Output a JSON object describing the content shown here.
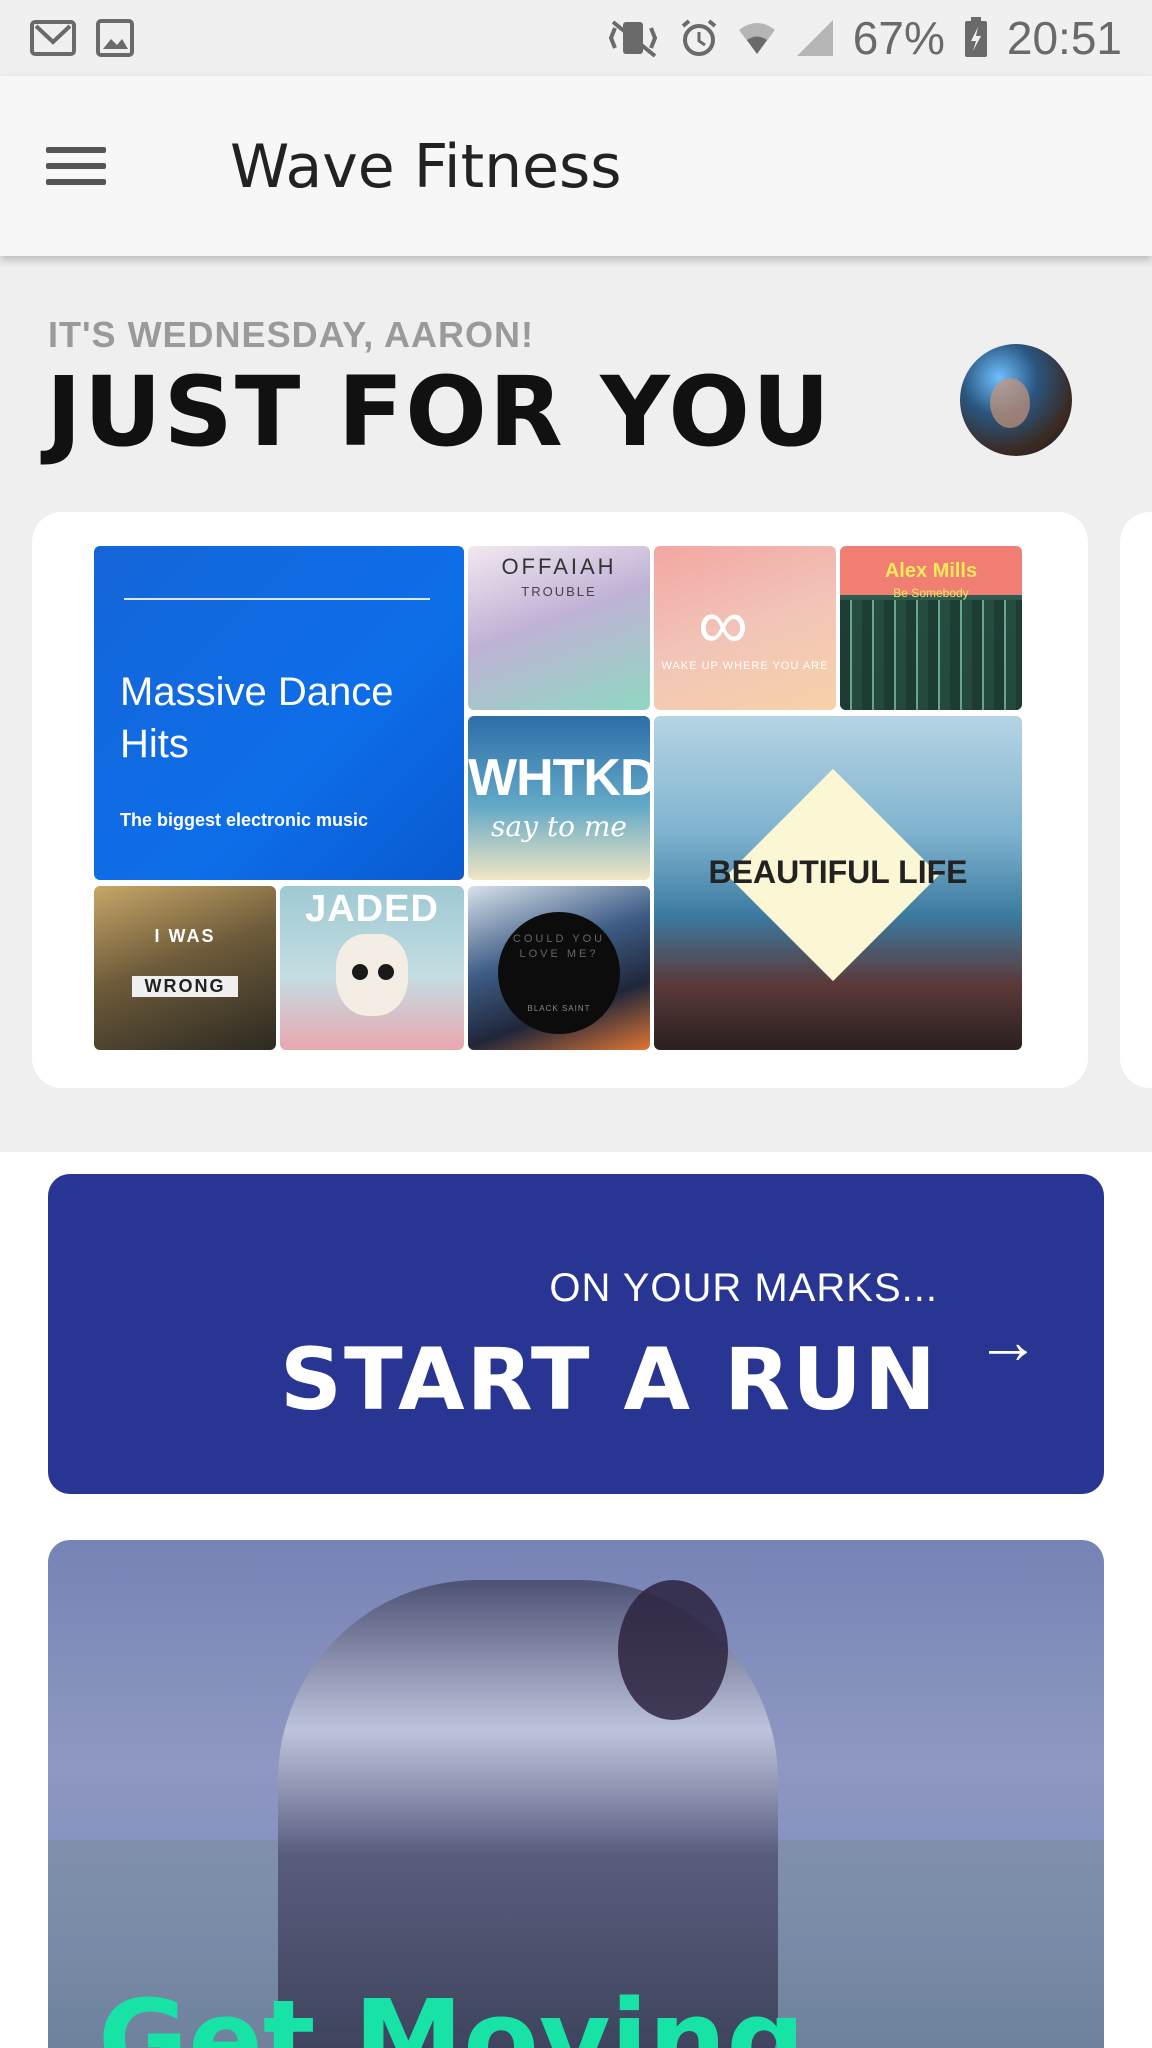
{
  "status_bar": {
    "battery": "67%",
    "time": "20:51",
    "icons": [
      "gmail-icon",
      "image-icon",
      "mute-vibrate-icon",
      "alarm-icon",
      "wifi-icon",
      "signal-icon",
      "battery-icon"
    ]
  },
  "app_bar": {
    "title": "Wave Fitness",
    "menu_icon": "menu-icon"
  },
  "hero": {
    "greeting": "IT'S WEDNESDAY, AARON!",
    "headline": "JUST FOR YOU"
  },
  "playlist": {
    "title": "Massive Dance Hits",
    "subtitle": "The biggest electronic music",
    "albums": {
      "offaiah": "OFFAIAH",
      "offaiah_sub": "TROUBLE",
      "state_of_sound": "WAKE UP WHERE YOU ARE",
      "alex_mills": "Alex Mills",
      "alex_mills_sub": "Be Somebody",
      "whtkd": "WHTKD",
      "whtkd_sub": "say to me",
      "beautiful_life": "BEAUTIFUL LIFE",
      "i_was": "I WAS",
      "i_was_wrong": "WRONG",
      "jaded": "JADED",
      "could_you": "COULD YOU LOVE ME?",
      "black_saint": "BLACK SAINT"
    }
  },
  "run_banner": {
    "pre": "ON YOUR MARKS...",
    "main": "START A RUN",
    "arrow": "→"
  },
  "moving_card": {
    "title": "Get Moving"
  },
  "colors": {
    "accent_blue": "#283593",
    "green": "#16e3a5",
    "playlist_blue": "#1565d8"
  }
}
